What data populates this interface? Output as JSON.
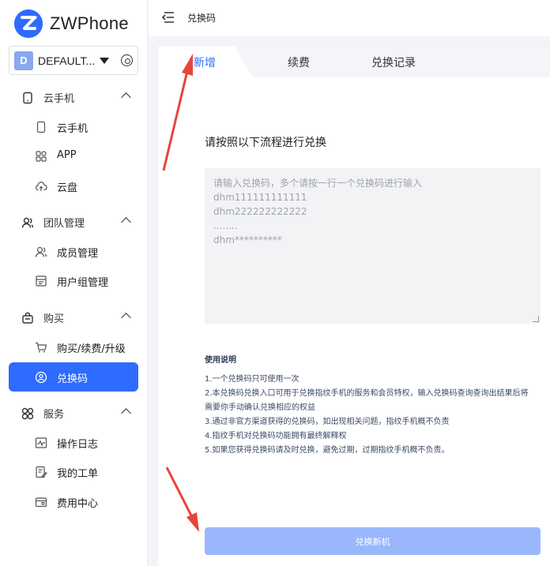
{
  "app": {
    "name": "ZWPhone"
  },
  "account": {
    "avatar_letter": "D",
    "name": "DEFAULT..."
  },
  "sidebar": {
    "groups": [
      {
        "label": "云手机",
        "items": [
          {
            "label": "云手机"
          },
          {
            "label": "APP"
          },
          {
            "label": "云盘"
          }
        ]
      },
      {
        "label": "团队管理",
        "items": [
          {
            "label": "成员管理"
          },
          {
            "label": "用户组管理"
          }
        ]
      },
      {
        "label": "购买",
        "items": [
          {
            "label": "购买/续费/升级"
          },
          {
            "label": "兑换码",
            "active": true
          }
        ]
      },
      {
        "label": "服务",
        "items": [
          {
            "label": "操作日志"
          },
          {
            "label": "我的工单"
          },
          {
            "label": "费用中心"
          }
        ]
      }
    ]
  },
  "header": {
    "breadcrumb": "兑换码"
  },
  "tabs": [
    {
      "label": "新增",
      "active": true
    },
    {
      "label": "续费"
    },
    {
      "label": "兑换记录"
    }
  ],
  "form": {
    "instruction": "请按照以下流程进行兑换",
    "placeholder_lines": [
      "请输入兑换码，多个请按一行一个兑换码进行输入",
      "dhm111111111111",
      "dhm222222222222",
      "........",
      "dhm**********"
    ],
    "submit_label": "兑换新机"
  },
  "usage": {
    "title": "使用说明",
    "lines": [
      "1.一个兑换码只可使用一次",
      "2.本兑换码兑换入口可用于兑换指纹手机的服务和会员特权，输入兑换码查询查询出结果后将",
      "需要你手动确认兑换相应的权益",
      "3.通过非官方渠道获得的兑换码，如出现相关问题，指纹手机概不负责",
      "4.指纹手机对兑换码功能拥有最终解释权",
      "5.如果您获得兑换码请及时兑换，避免过期，过期指纹手机概不负责。"
    ]
  },
  "colors": {
    "accent": "#2f6bff",
    "button_disabled": "#9bb7fb",
    "annotation_arrow": "#e9443a"
  }
}
